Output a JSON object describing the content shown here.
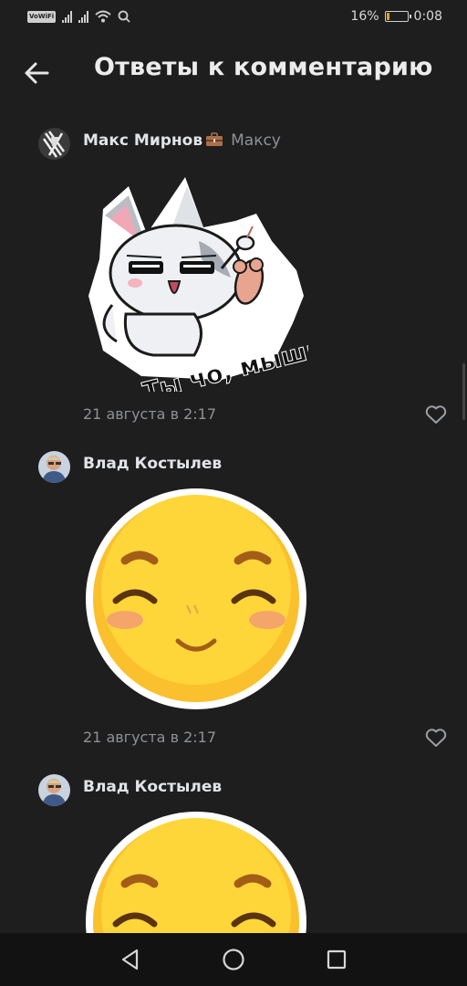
{
  "status_bar": {
    "vowifi": "VoWiFi",
    "battery_percent": "16%",
    "battery_level": 0.16,
    "battery_color": "#f0a30a",
    "time": "0:08"
  },
  "header": {
    "title": "Ответы к комментарию",
    "back_icon": "arrow-left-icon"
  },
  "comments": [
    {
      "author": "Макс Мирнов",
      "author_badge_icon": "briefcase-icon",
      "reply_to": "Максу",
      "sticker": "Ты чо, мышь?",
      "timestamp": "21 августа в 2:17",
      "like_icon": "heart-outline-icon"
    },
    {
      "author": "Влад Костылев",
      "sticker": "smiling-face-sticker",
      "timestamp": "21 августа в 2:17",
      "like_icon": "heart-outline-icon"
    },
    {
      "author": "Влад Костылев",
      "sticker": "smiling-face-sticker"
    }
  ],
  "nav_bar": {
    "back_icon": "triangle-back-icon",
    "home_icon": "circle-home-icon",
    "recents_icon": "square-recents-icon"
  }
}
